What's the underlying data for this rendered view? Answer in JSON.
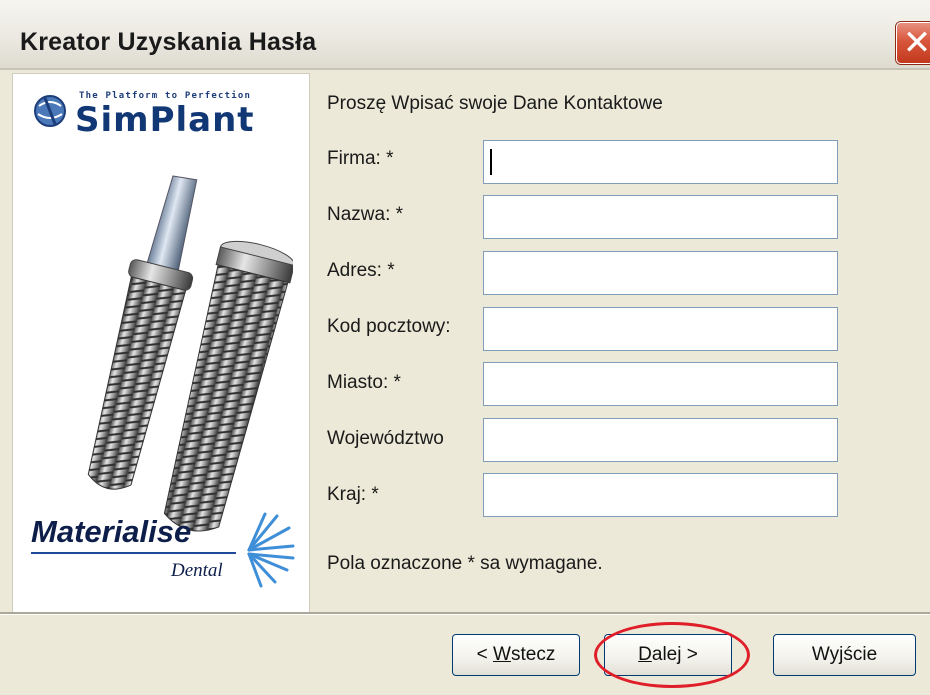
{
  "window": {
    "title": "Kreator Uzyskania Hasła",
    "close_glyph": "✕"
  },
  "branding": {
    "tagline": "The Platform to Perfection",
    "product": "SimPlant",
    "company": "Materialise",
    "division": "Dental"
  },
  "form": {
    "heading": "Proszę Wpisać swoje Dane Kontaktowe",
    "fields": [
      {
        "label": "Firma: *",
        "value": ""
      },
      {
        "label": "Nazwa: *",
        "value": ""
      },
      {
        "label": "Adres: *",
        "value": ""
      },
      {
        "label": "Kod pocztowy:",
        "value": ""
      },
      {
        "label": "Miasto: *",
        "value": ""
      },
      {
        "label": "Województwo",
        "value": ""
      },
      {
        "label": "Kraj: *",
        "value": ""
      }
    ],
    "footnote": "Pola oznaczone * sa wymagane."
  },
  "buttons": {
    "back": {
      "prefix": "< ",
      "accel": "W",
      "rest": "stecz"
    },
    "next": {
      "accel": "D",
      "rest": "alej >"
    },
    "exit": {
      "pre": "Wy",
      "accel": "j",
      "rest": "ście"
    }
  },
  "colors": {
    "highlight_ellipse": "#e01e2a",
    "close_button": "#d8563c"
  },
  "icons": [
    "close-icon",
    "simplant-logo-icon",
    "implant-illustration",
    "materialise-star-icon"
  ]
}
